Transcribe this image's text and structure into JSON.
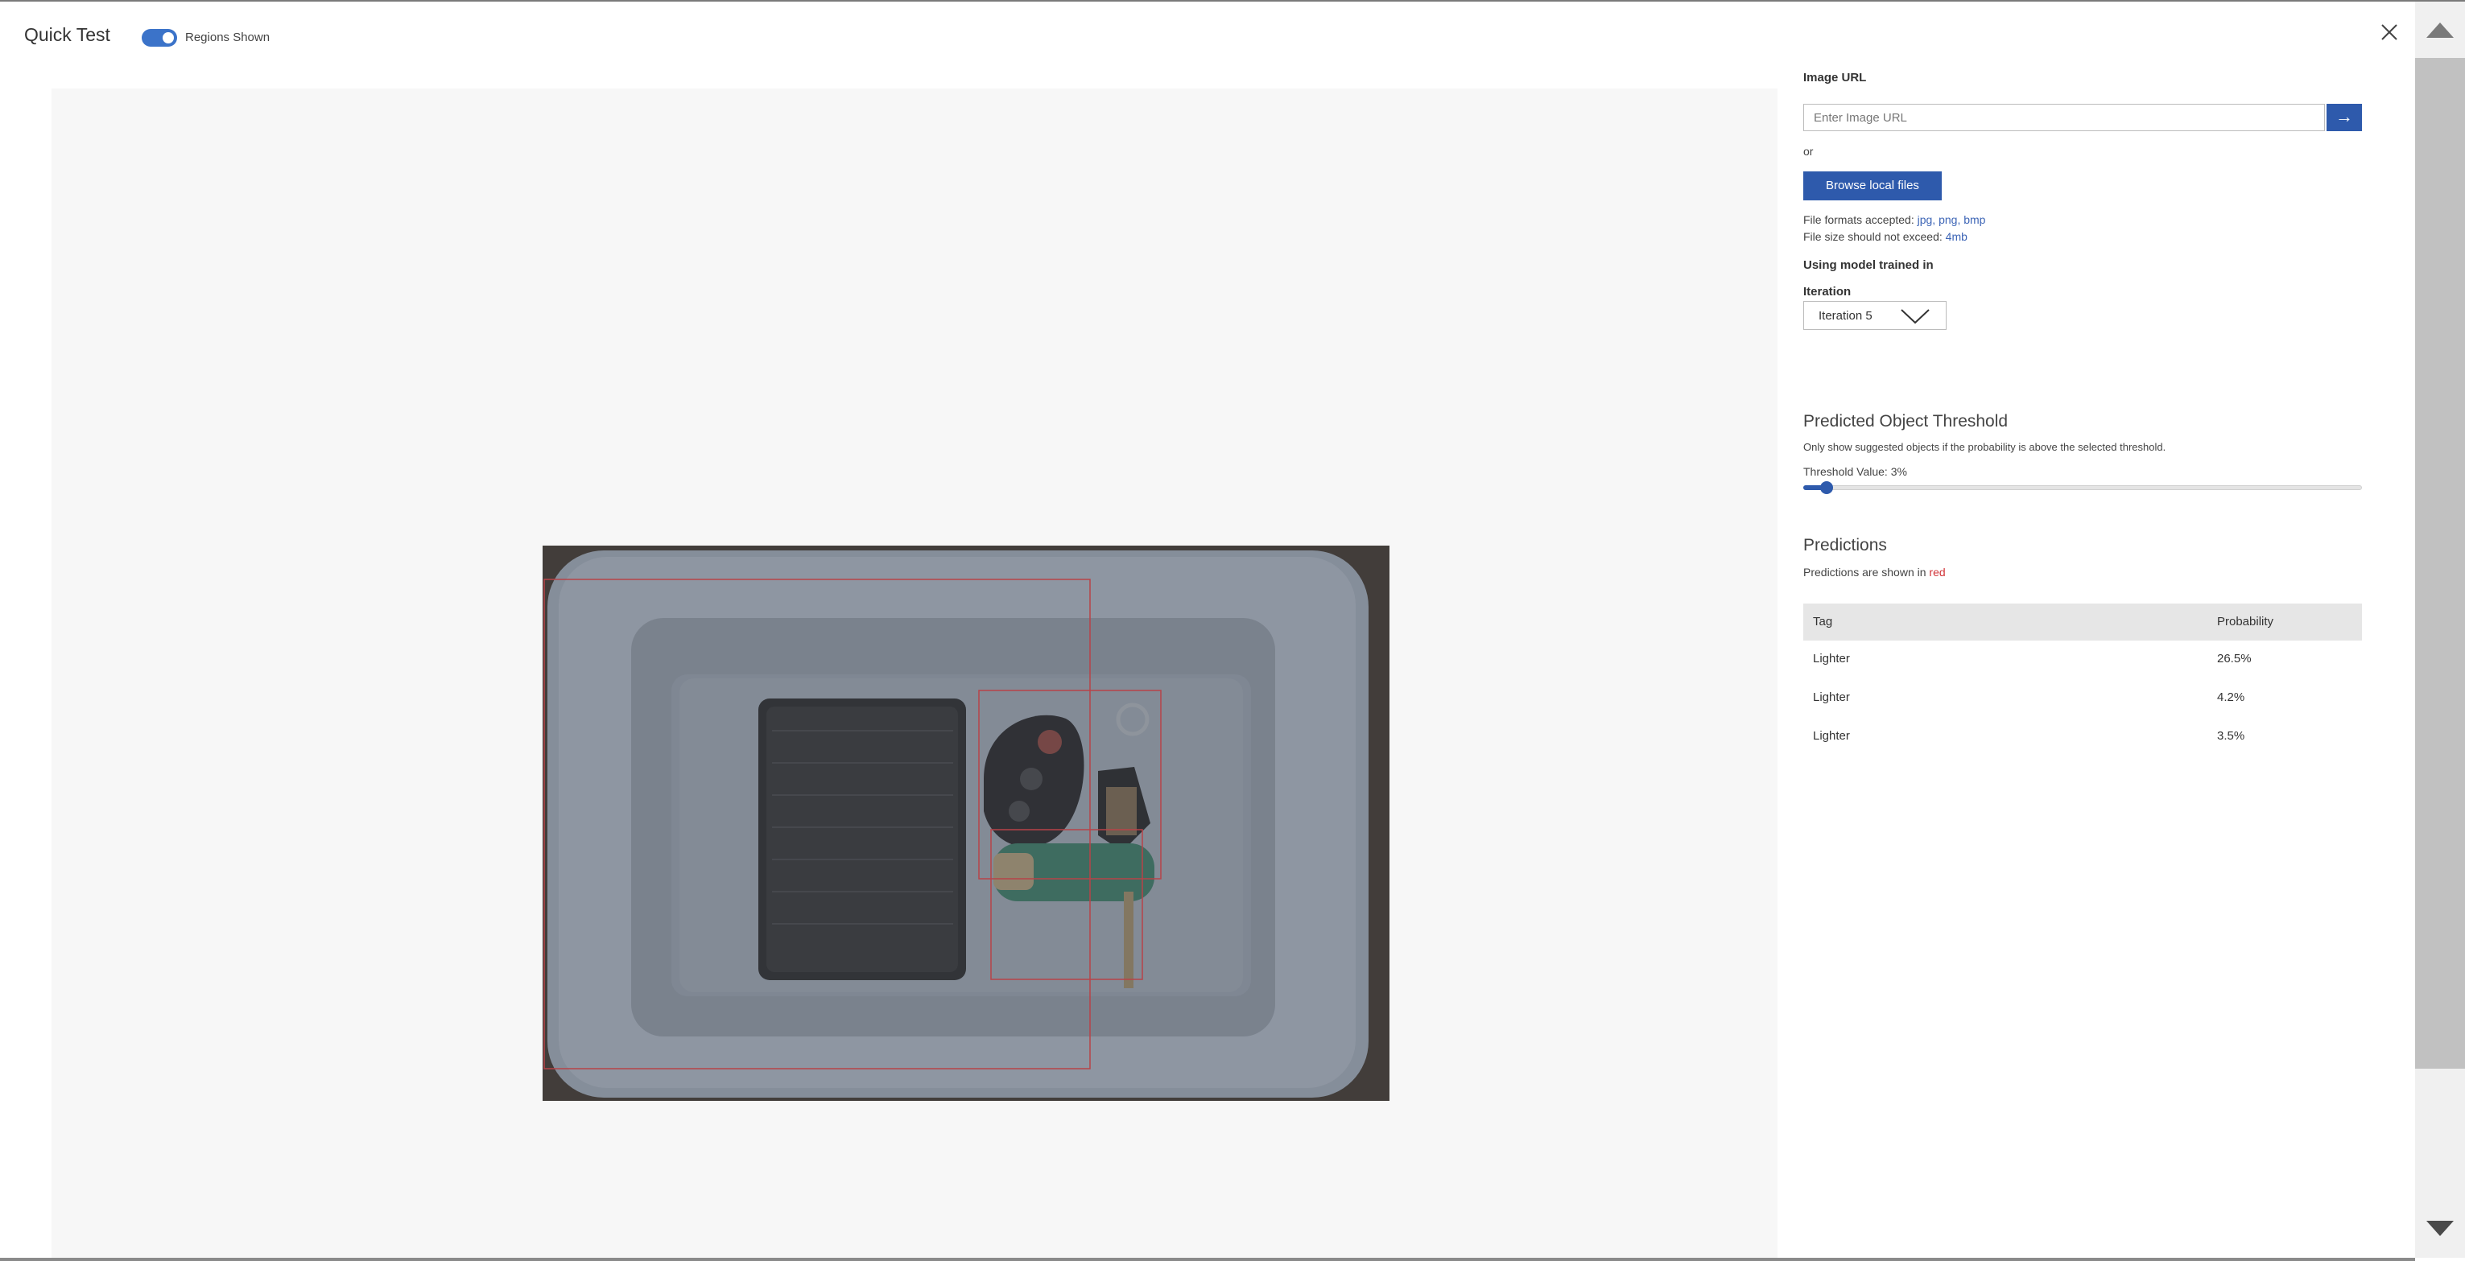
{
  "header": {
    "title": "Quick Test",
    "toggle_label": "Regions Shown",
    "toggle_on": true
  },
  "panel": {
    "image_url_label": "Image URL",
    "image_url_placeholder": "Enter Image URL",
    "or_text": "or",
    "browse_label": "Browse local files",
    "formats_label": "File formats accepted:",
    "formats_value": "jpg, png, bmp",
    "size_label": "File size should not exceed:",
    "size_value": "4mb",
    "model_label": "Using model trained in",
    "iteration_label": "Iteration",
    "iteration_selected": "Iteration 5",
    "threshold_title": "Predicted Object Threshold",
    "threshold_desc": "Only show suggested objects if the probability is above the selected threshold.",
    "threshold_value_text": "Threshold Value: 3%",
    "threshold_value": 3,
    "predictions_title": "Predictions",
    "predictions_desc": "Predictions are shown in",
    "predictions_color_word": "red"
  },
  "predictions": {
    "headers": {
      "tag": "Tag",
      "probability": "Probability"
    },
    "rows": [
      {
        "tag": "Lighter",
        "probability": "26.5%"
      },
      {
        "tag": "Lighter",
        "probability": "4.2%"
      },
      {
        "tag": "Lighter",
        "probability": "3.5%"
      }
    ]
  },
  "colors": {
    "accent": "#2e5aac",
    "prediction_box": "#d13438"
  },
  "icons": {
    "close": "close-icon",
    "go": "arrow-right-icon",
    "dropdown": "chevron-down-icon",
    "scroll_up": "triangle-up-icon",
    "scroll_down": "triangle-down-icon"
  }
}
